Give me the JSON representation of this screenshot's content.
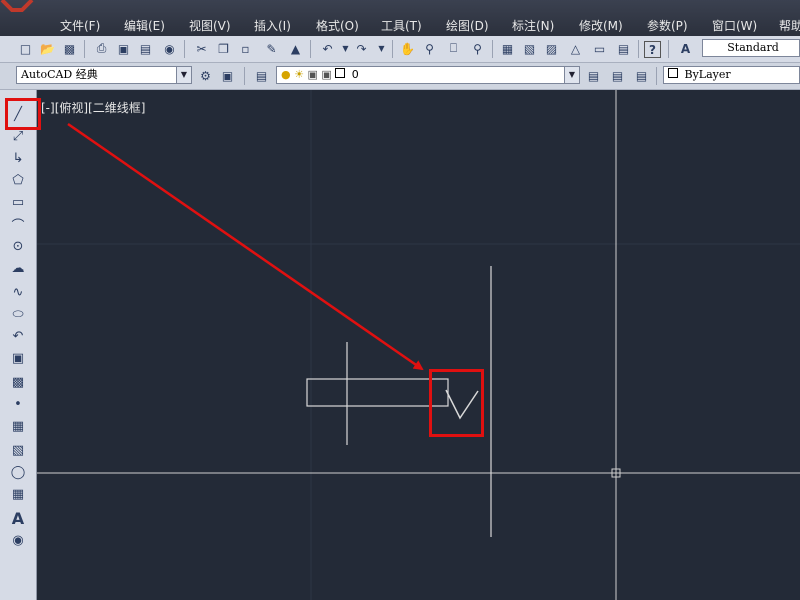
{
  "menus": [
    "文件(F)",
    "编辑(E)",
    "视图(V)",
    "插入(I)",
    "格式(O)",
    "工具(T)",
    "绘图(D)",
    "标注(N)",
    "修改(M)",
    "参数(P)",
    "窗口(W)",
    "帮助"
  ],
  "toolbar": {
    "text_style": "Standard",
    "workspace": "AutoCAD 经典",
    "layer": "0",
    "color": "ByLayer"
  },
  "viewport": {
    "label": "[-][俯视][二维线框]"
  },
  "colors": {
    "canvas_bg": "#232a37",
    "annotation_red": "#e01010",
    "drawing_lines": "#d8d8d8"
  },
  "icons": {
    "left_toolbar": [
      "line-icon",
      "construction-line-icon",
      "polyline-icon",
      "polygon-icon",
      "rectangle-icon",
      "arc-icon",
      "circle-icon",
      "revision-cloud-icon",
      "spline-icon",
      "ellipse-icon",
      "ellipse-arc-icon",
      "insert-block-icon",
      "make-block-icon",
      "point-icon",
      "hatch-icon",
      "gradient-icon",
      "region-icon",
      "table-icon",
      "multiline-text-icon",
      "add-selected-icon"
    ]
  }
}
